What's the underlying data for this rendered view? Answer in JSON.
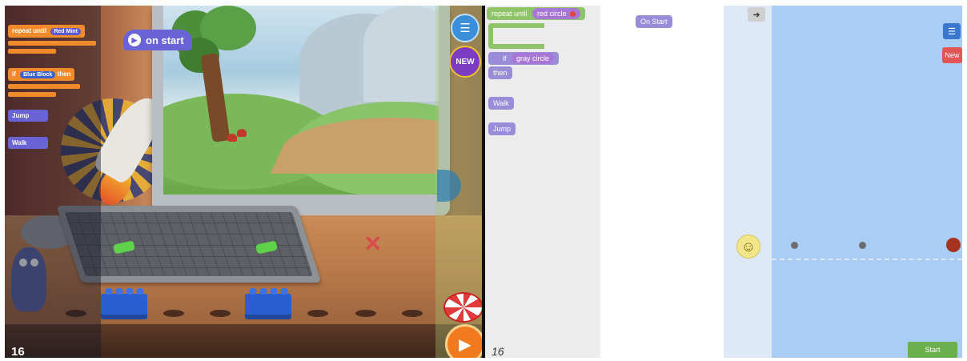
{
  "left_panel": {
    "code_blocks": {
      "repeat_until": {
        "label": "repeat until",
        "tag": "Red Mint"
      },
      "if_block": {
        "label": "if",
        "tag": "Blue Block",
        "suffix": "then"
      },
      "jump": "Jump",
      "walk": "Walk"
    },
    "on_start_label": "on start",
    "new_badge": "NEW",
    "level_number": "16"
  },
  "right_panel": {
    "palette": {
      "repeat_until": {
        "label": "repeat until",
        "tag": "red circle"
      },
      "if_block": {
        "label": "if",
        "tag": "gray circle",
        "then": "then"
      },
      "walk": "Walk",
      "jump": "Jump"
    },
    "workspace": {
      "on_start": "On Start"
    },
    "stage": {
      "arrow_icon": "arrow-right-icon",
      "new_label": "New",
      "start_label": "Start",
      "smiley_icon": "smiley-face-icon",
      "ball_color": "#a5321f",
      "dot_color": "#6d6d6d"
    },
    "level_number": "16"
  },
  "colors": {
    "orange_block": "#f08a2a",
    "purple_block": "#6a63d8",
    "green_block": "#8fc468",
    "stage_blue": "#a9cdf5",
    "start_green": "#6ab04c"
  }
}
